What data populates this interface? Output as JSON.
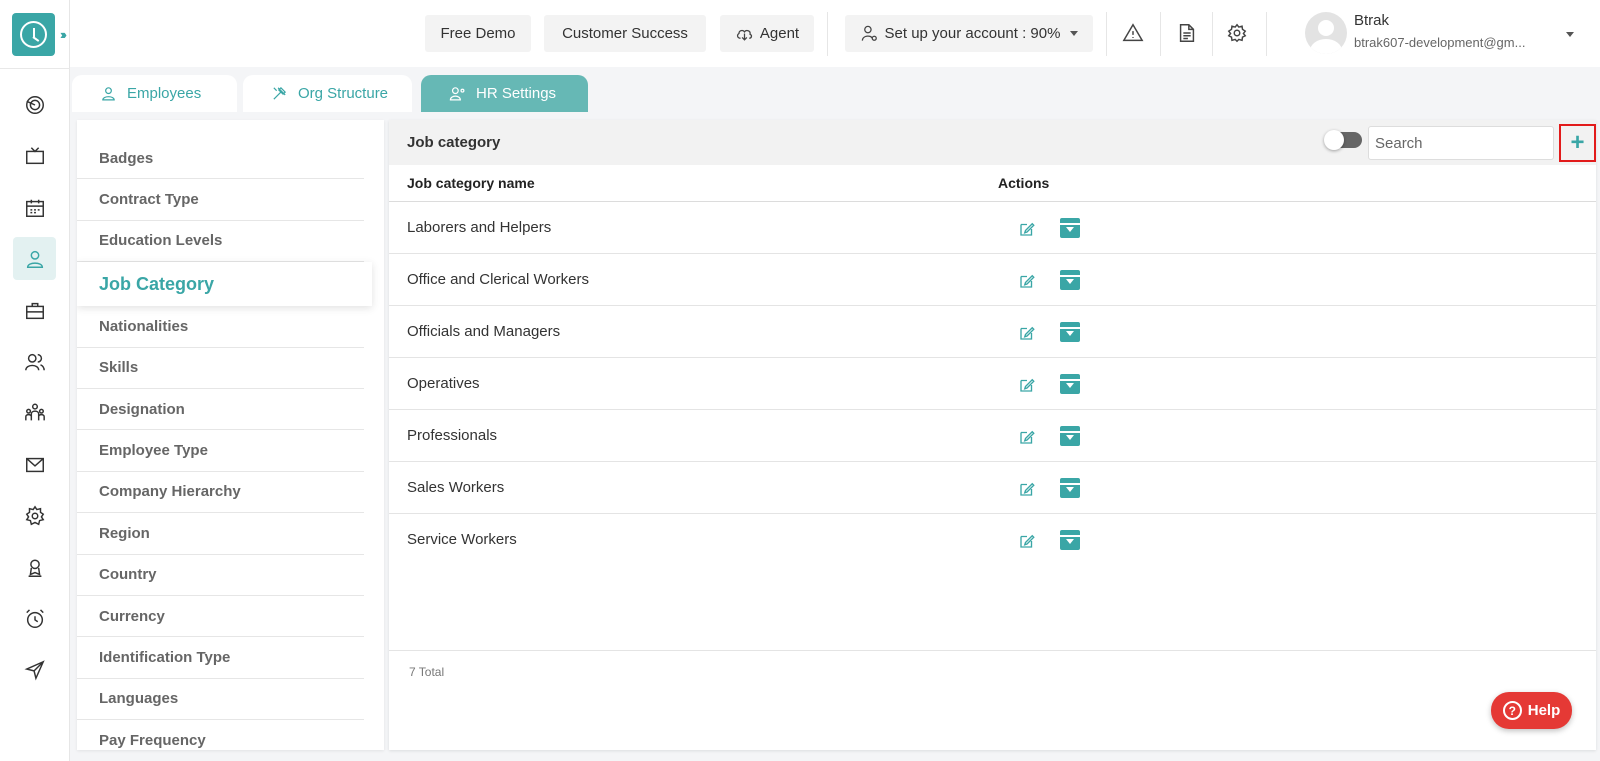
{
  "topbar": {
    "free_demo": "Free Demo",
    "customer_success": "Customer Success",
    "agent": "Agent",
    "setup": "Set up your account : 90%",
    "user_name": "Btrak",
    "user_email": "btrak607-development@gm..."
  },
  "tabs": [
    {
      "label": "Employees",
      "icon": "user-icon"
    },
    {
      "label": "Org Structure",
      "icon": "tools-icon"
    },
    {
      "label": "HR Settings",
      "icon": "user-settings-icon"
    }
  ],
  "menu": {
    "items": [
      "Badges",
      "Contract Type",
      "Education Levels",
      "Job Category",
      "Nationalities",
      "Skills",
      "Designation",
      "Employee Type",
      "Company Hierarchy",
      "Region",
      "Country",
      "Currency",
      "Identification Type",
      "Languages",
      "Pay Frequency"
    ],
    "active": "Job Category"
  },
  "panel": {
    "title": "Job category",
    "search_placeholder": "Search",
    "add_symbol": "+",
    "columns": [
      "Job category name",
      "Actions"
    ],
    "rows": [
      "Laborers and Helpers",
      "Office and Clerical Workers",
      "Officials and Managers",
      "Operatives",
      "Professionals",
      "Sales Workers",
      "Service Workers"
    ],
    "total": "7 Total"
  },
  "help": {
    "label": "Help"
  },
  "colors": {
    "accent": "#3aa6a6",
    "tab_active": "#66b8b5",
    "help": "#e53935",
    "highlight": "#e21b1b"
  }
}
